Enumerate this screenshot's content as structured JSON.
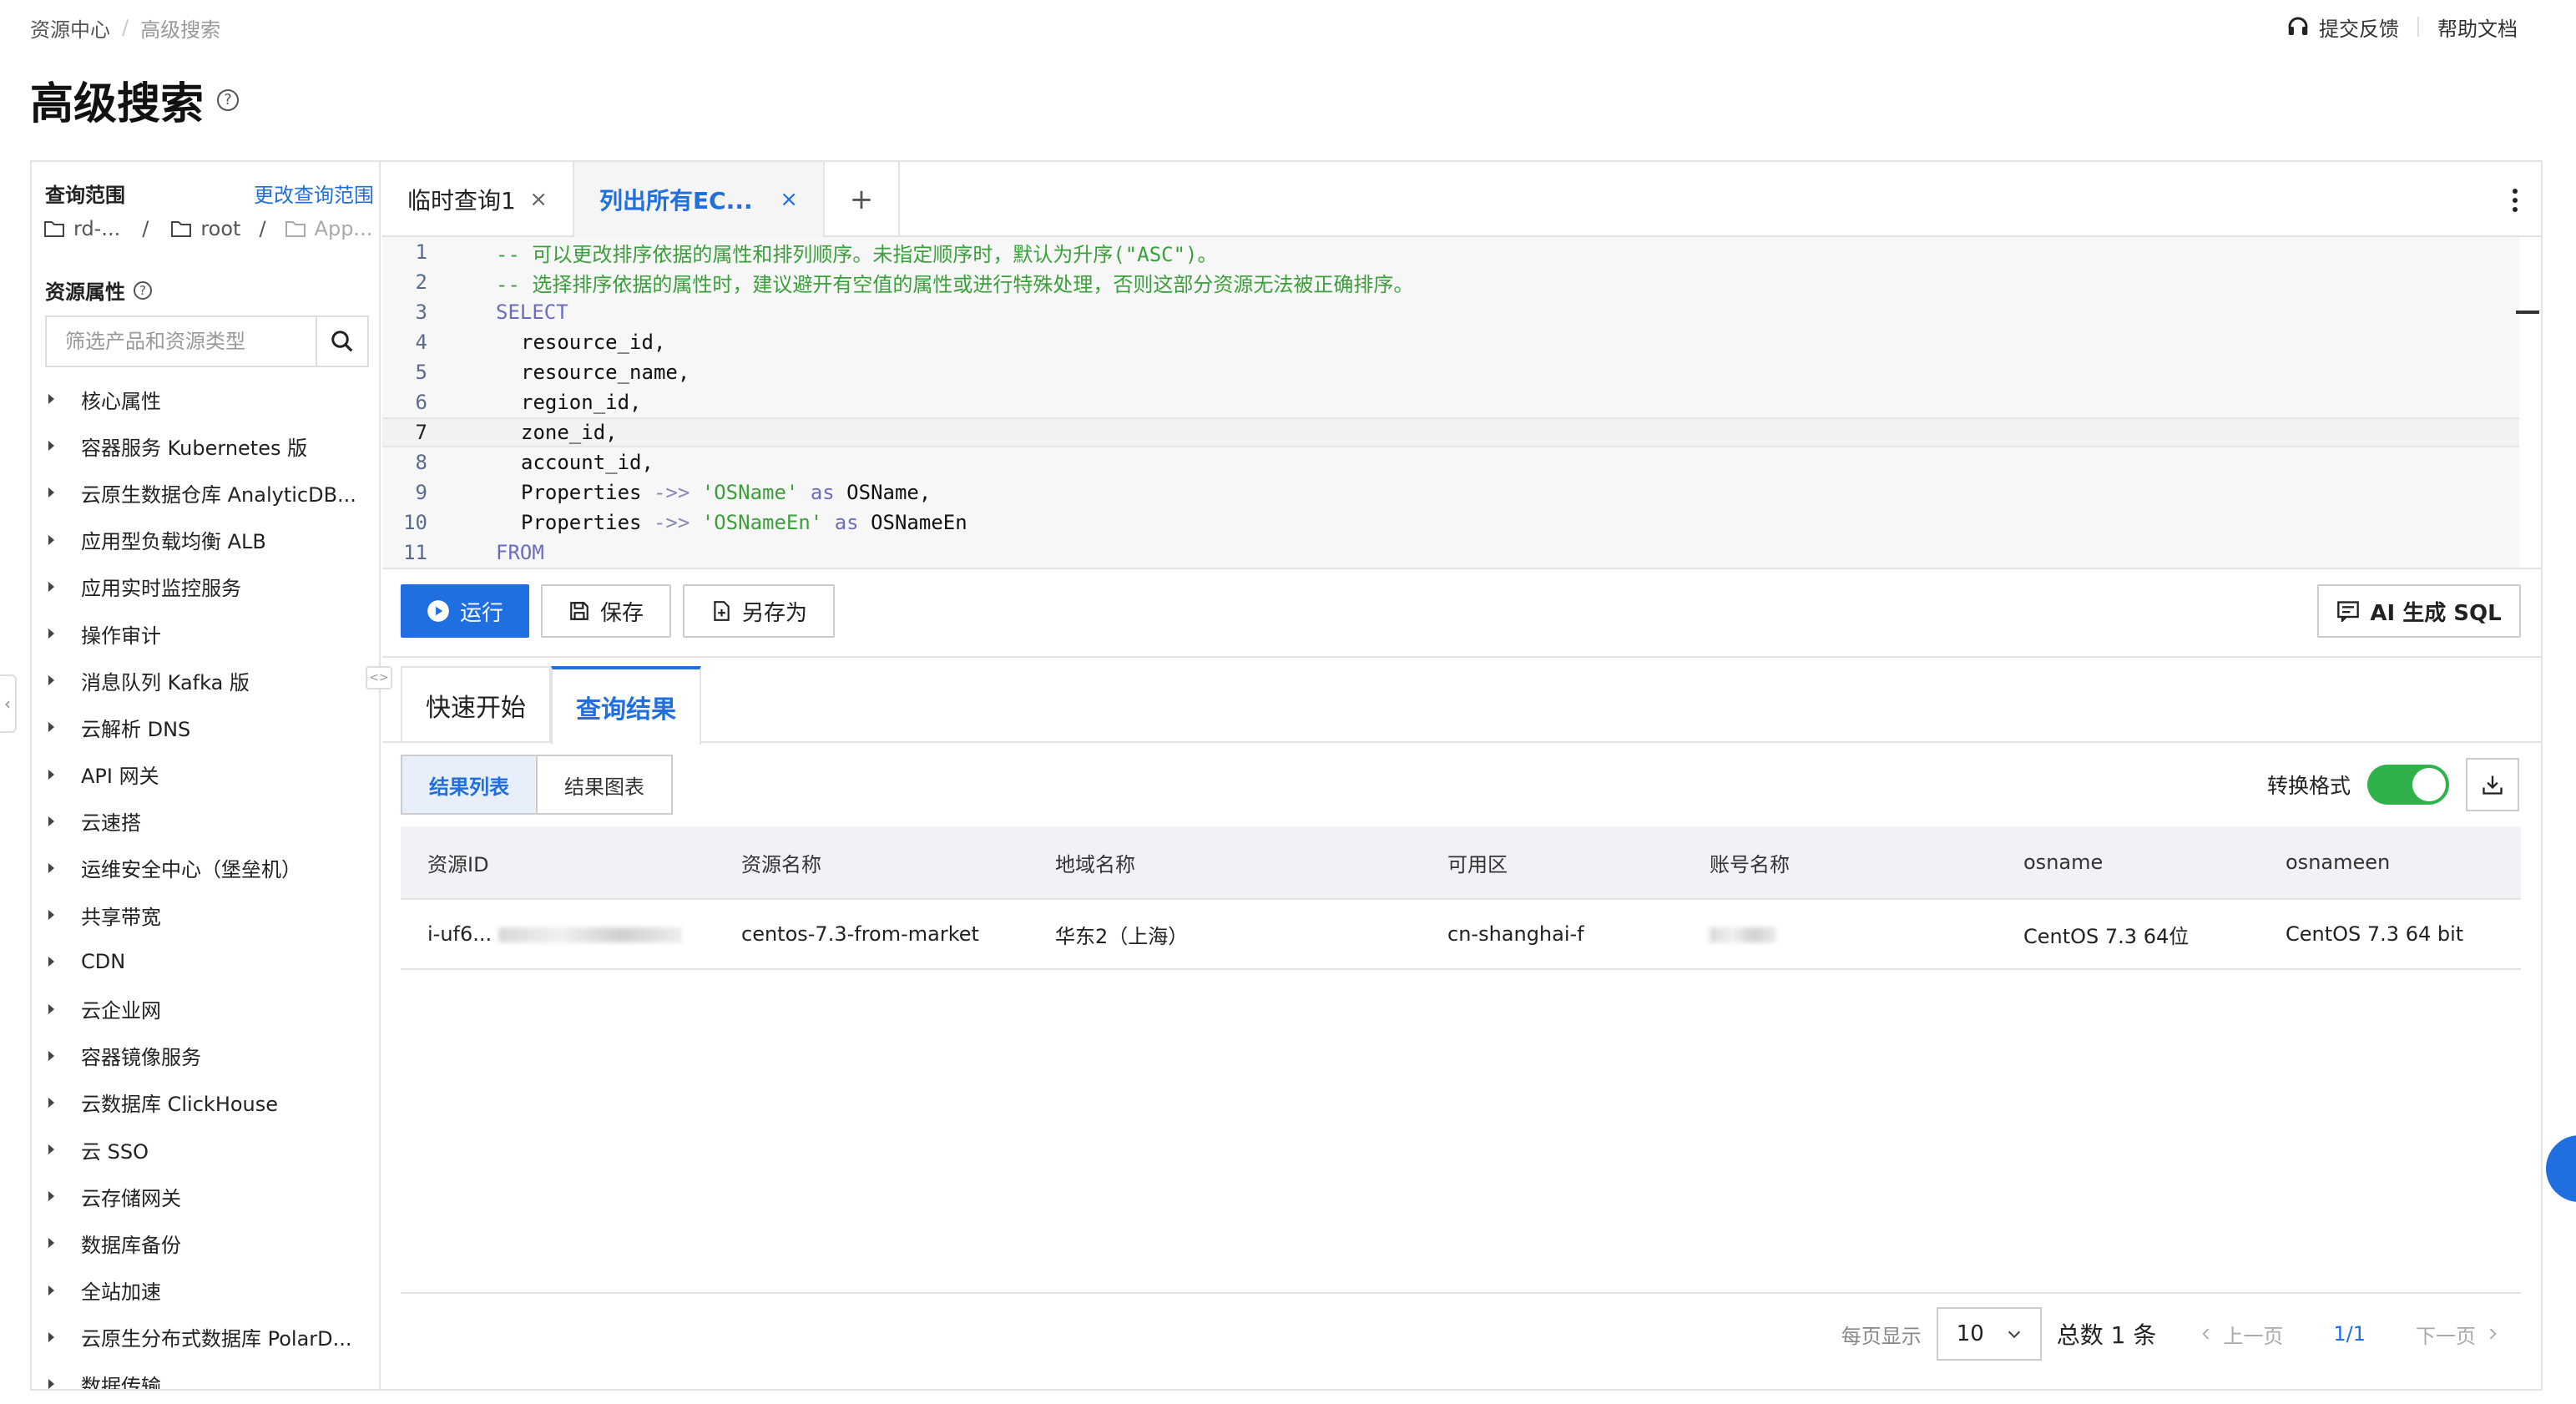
{
  "breadcrumb": {
    "root": "资源中心",
    "separator": "/",
    "current": "高级搜索"
  },
  "top_links": {
    "feedback": "提交反馈",
    "docs": "帮助文档"
  },
  "page": {
    "title": "高级搜索",
    "help_glyph": "?"
  },
  "sidebar": {
    "scope_label": "查询范围",
    "change_scope": "更改查询范围",
    "path": [
      "rd-...",
      "root",
      "App..."
    ],
    "path_sep": "/",
    "attr_label": "资源属性",
    "search_placeholder": "筛选产品和资源类型",
    "items": [
      "核心属性",
      "容器服务 Kubernetes 版",
      "云原生数据仓库 AnalyticDB...",
      "应用型负载均衡 ALB",
      "应用实时监控服务",
      "操作审计",
      "消息队列 Kafka 版",
      "云解析 DNS",
      "API 网关",
      "云速搭",
      "运维安全中心（堡垒机）",
      "共享带宽",
      "CDN",
      "云企业网",
      "容器镜像服务",
      "云数据库 ClickHouse",
      "云 SSO",
      "云存储网关",
      "数据库备份",
      "全站加速",
      "云原生分布式数据库 PolarD...",
      "数据传输"
    ]
  },
  "tabs": [
    {
      "label": "临时查询1",
      "active": false
    },
    {
      "label": "列出所有EC...",
      "active": true
    }
  ],
  "tab_add": "+",
  "tab_close": "×",
  "editor": {
    "line_numbers": [
      "1",
      "2",
      "3",
      "4",
      "5",
      "6",
      "7",
      "8",
      "9",
      "10",
      "11"
    ],
    "comment1": "-- 可以更改排序依据的属性和排列顺序。未指定顺序时，默认为升序(\"ASC\")。",
    "comment2": "-- 选择排序依据的属性时，建议避开有空值的属性或进行特殊处理，否则这部分资源无法被正确排序。",
    "select_kw": "SELECT",
    "f4": "resource_id,",
    "f5": "resource_name,",
    "f6": "region_id,",
    "f7": "zone_id,",
    "f8": "account_id,",
    "props": "Properties",
    "arrow": "->>",
    "str9": "'OSName'",
    "as_kw": "as",
    "alias9": "OSName,",
    "str10": "'OSNameEn'",
    "alias10": "OSNameEn",
    "from_kw": "FROM"
  },
  "actions": {
    "run": "运行",
    "save": "保存",
    "save_as": "另存为",
    "ai_sql": "AI 生成 SQL"
  },
  "result_tabs": {
    "quick_start": "快速开始",
    "results": "查询结果"
  },
  "result_view": {
    "list": "结果列表",
    "chart": "结果图表",
    "convert_label": "转换格式",
    "convert_on": true
  },
  "table": {
    "headers": [
      "资源ID",
      "资源名称",
      "地域名称",
      "可用区",
      "账号名称",
      "osname",
      "osnameen"
    ],
    "rows": [
      [
        "i-uf6...",
        "centos-7.3-from-market",
        "华东2（上海）",
        "cn-shanghai-f",
        "",
        "CentOS  7.3 64位",
        "CentOS  7.3 64 bit"
      ]
    ]
  },
  "pagination": {
    "per_page_label": "每页显示",
    "per_page": "10",
    "total": "总数 1 条",
    "prev": "上一页",
    "page": "1/1",
    "next": "下一页"
  },
  "colors": {
    "accent": "#1f6fe0",
    "toggle_on": "#2fb24a"
  }
}
